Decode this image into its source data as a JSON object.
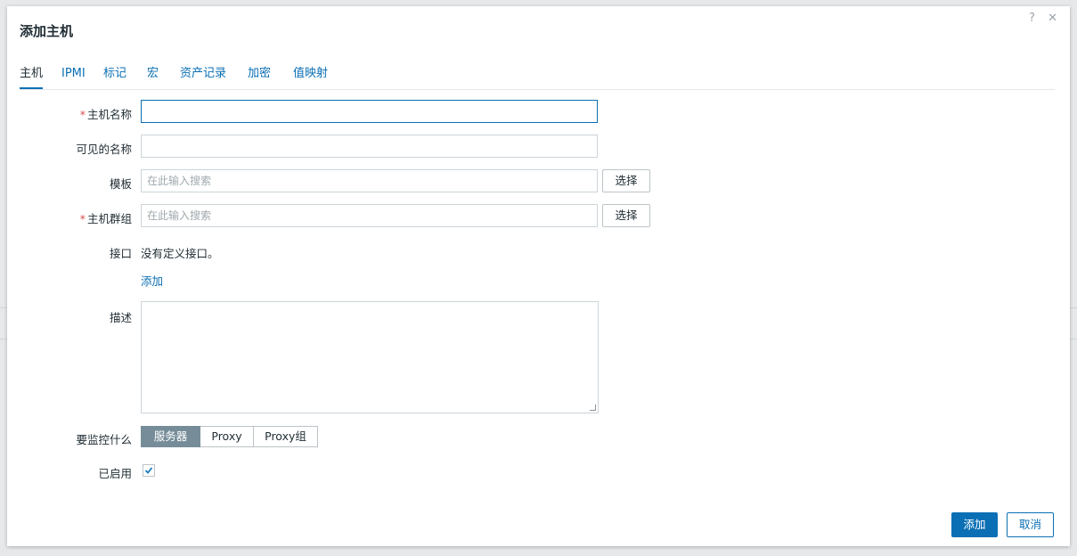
{
  "dialog": {
    "title": "添加主机",
    "help_icon": "?",
    "close_icon": "✕"
  },
  "tabs": [
    {
      "label": "主机",
      "active": true
    },
    {
      "label": "IPMI"
    },
    {
      "label": "标记"
    },
    {
      "label": "宏"
    },
    {
      "label": "资产记录"
    },
    {
      "label": "加密"
    },
    {
      "label": "值映射"
    }
  ],
  "form": {
    "required_mark": "*",
    "host_name": {
      "label": "主机名称",
      "value": ""
    },
    "visible_name": {
      "label": "可见的名称",
      "value": ""
    },
    "templates": {
      "label": "模板",
      "placeholder": "在此输入搜索",
      "button": "选择"
    },
    "host_groups": {
      "label": "主机群组",
      "placeholder": "在此输入搜索",
      "button": "选择"
    },
    "interfaces": {
      "label": "接口",
      "empty_text": "没有定义接口。",
      "add_link": "添加"
    },
    "description": {
      "label": "描述",
      "value": ""
    },
    "monitored_by": {
      "label": "要监控什么",
      "options": [
        "服务器",
        "Proxy",
        "Proxy组"
      ],
      "selected": "服务器"
    },
    "enabled": {
      "label": "已启用",
      "checked": true
    }
  },
  "footer": {
    "add_button": "添加",
    "cancel_button": "取消"
  },
  "colors": {
    "accent": "#0a6fb4",
    "required": "#d64e4e",
    "segment_selected": "#768d99"
  }
}
